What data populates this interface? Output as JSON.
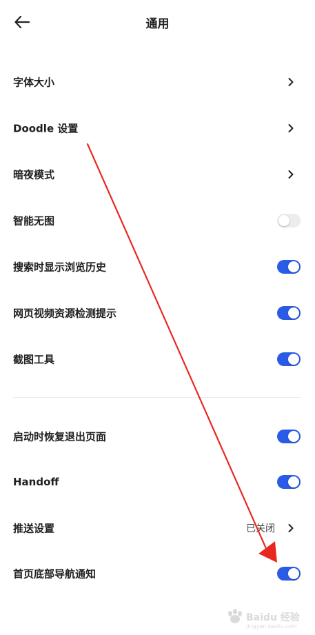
{
  "header": {
    "title": "通用",
    "back_icon": "arrow-left-icon"
  },
  "settings": {
    "font_size": {
      "label": "字体大小"
    },
    "doodle": {
      "label": "Doodle 设置"
    },
    "dark_mode": {
      "label": "暗夜模式"
    },
    "smart_no_image": {
      "label": "智能无图",
      "enabled": false
    },
    "search_history": {
      "label": "搜索时显示浏览历史",
      "enabled": true
    },
    "video_detect": {
      "label": "网页视频资源检测提示",
      "enabled": true
    },
    "screenshot_tool": {
      "label": "截图工具",
      "enabled": true
    },
    "restore_on_start": {
      "label": "启动时恢复退出页面",
      "enabled": true
    },
    "handoff": {
      "label": "Handoff",
      "enabled": true
    },
    "push": {
      "label": "推送设置",
      "value": "已关闭"
    },
    "bottom_nav_notify": {
      "label": "首页底部导航通知",
      "enabled": true
    }
  },
  "colors": {
    "toggle_on": "#2a5be6",
    "toggle_off": "#ececec",
    "annotation_arrow": "#e8281e"
  },
  "watermark": {
    "text": "Baidu 经验",
    "subtext": "jingyan.baidu.com"
  }
}
